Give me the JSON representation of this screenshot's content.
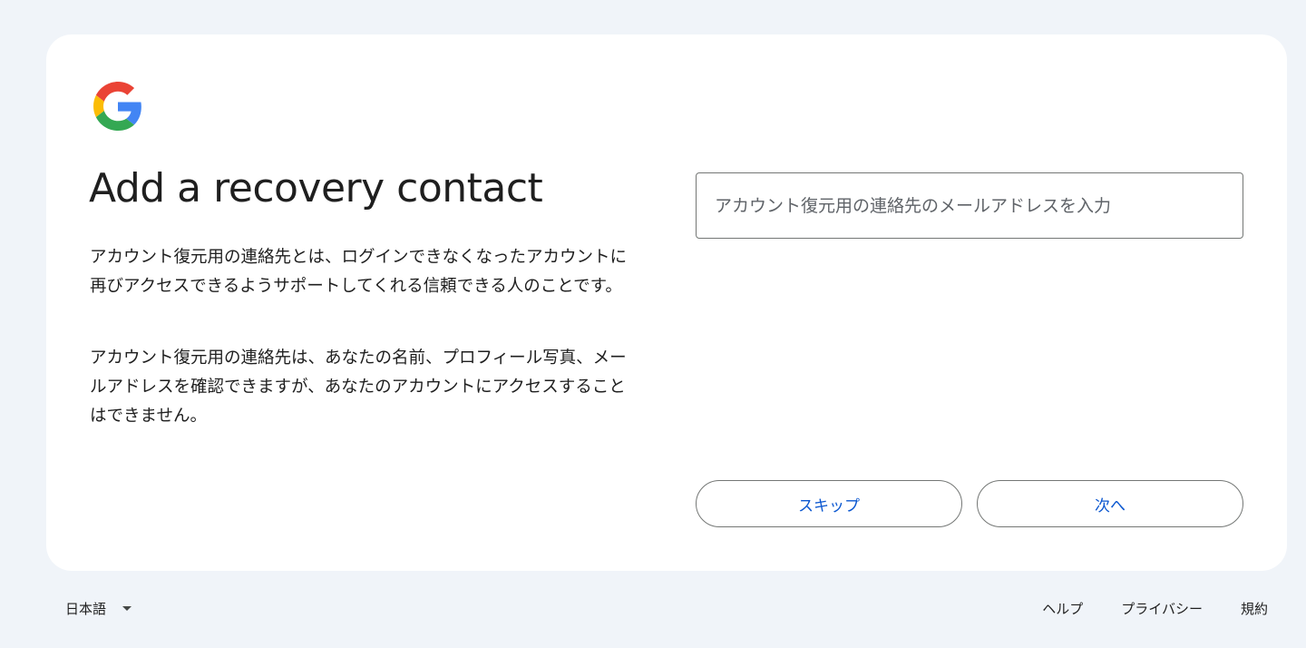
{
  "card": {
    "title": "Add a recovery contact",
    "description_1": "アカウント復元用の連絡先とは、ログインできなくなったアカウントに再びアクセスできるようサポートしてくれる信頼できる人のことです。",
    "description_2": "アカウント復元用の連絡先は、あなたの名前、プロフィール写真、メールアドレスを確認できますが、あなたのアカウントにアクセスすることはできません。"
  },
  "form": {
    "email_placeholder": "アカウント復元用の連絡先のメールアドレスを入力",
    "email_value": ""
  },
  "actions": {
    "skip_label": "スキップ",
    "next_label": "次へ"
  },
  "footer": {
    "language": "日本語",
    "help": "ヘルプ",
    "privacy": "プライバシー",
    "terms": "規約"
  },
  "colors": {
    "page_background": "#f0f4f9",
    "card_background": "#ffffff",
    "accent": "#0b57d0",
    "border": "#747775"
  },
  "icons": {
    "logo": "google-g-logo-icon",
    "language_caret": "caret-down-icon"
  }
}
